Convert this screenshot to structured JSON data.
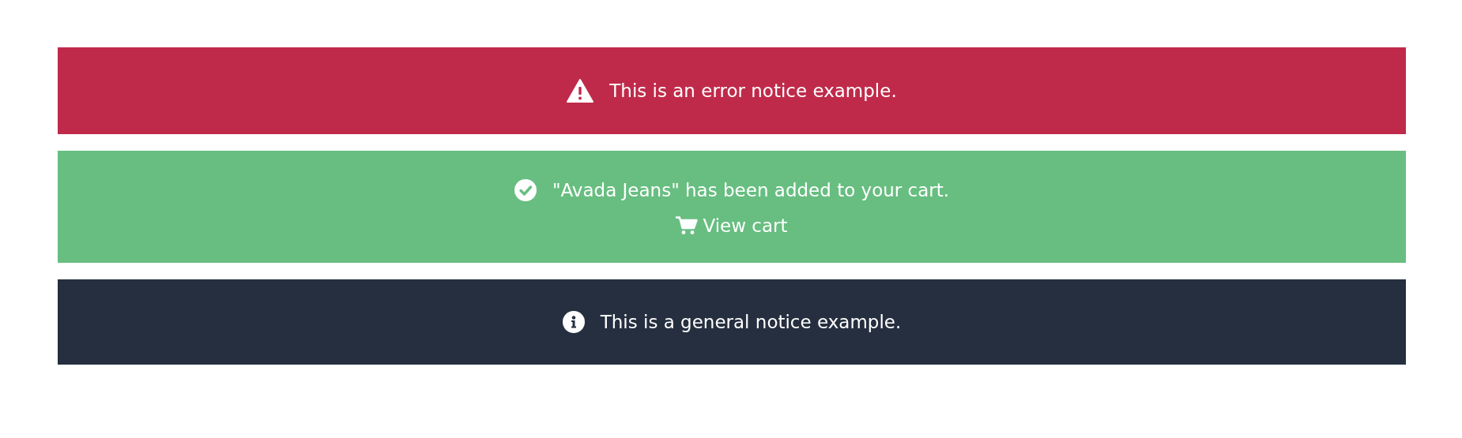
{
  "notices": [
    {
      "kind": "error",
      "message": "This is an error notice example."
    },
    {
      "kind": "success",
      "message": "\"Avada Jeans\" has been added to your cart.",
      "link": "View cart"
    },
    {
      "kind": "info",
      "message": "This is a general notice example."
    }
  ]
}
